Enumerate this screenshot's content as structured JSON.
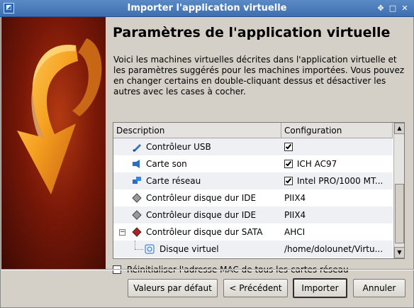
{
  "window": {
    "title": "Importer l'application virtuelle",
    "controls": [
      "up-arrow-icon",
      "restore-icon",
      "close-icon"
    ]
  },
  "page": {
    "heading": "Paramètres de l'application virtuelle",
    "description": "Voici les machines virtuelles décrites dans l'application virtuelle et les paramètres suggérés pour les machines importées. Vous pouvez en changer certains en double-cliquant dessus et désactiver les autres avec les cases à cocher."
  },
  "table": {
    "columns": [
      "Description",
      "Configuration"
    ],
    "rows": [
      {
        "icon": "usb-icon",
        "label": "Contrôleur USB",
        "checked": true,
        "value": ""
      },
      {
        "icon": "sound-card-icon",
        "label": "Carte son",
        "checked": true,
        "value": "ICH AC97"
      },
      {
        "icon": "network-card-icon",
        "label": "Carte réseau",
        "checked": true,
        "value": "Intel PRO/1000 MT..."
      },
      {
        "icon": "ide-controller-icon",
        "label": "Contrôleur disque dur IDE",
        "checked": null,
        "value": "PIIX4"
      },
      {
        "icon": "ide-controller-icon",
        "label": "Contrôleur disque dur IDE",
        "checked": null,
        "value": "PIIX4"
      },
      {
        "icon": "sata-controller-icon",
        "label": "Contrôleur disque dur SATA",
        "checked": null,
        "value": "AHCI"
      },
      {
        "icon": "virtual-disk-icon",
        "label": "Disque virtuel",
        "checked": null,
        "value": "/home/dolounet/Virtu..."
      }
    ]
  },
  "options": {
    "reset_mac_label": "Réinitialiser l'adresse MAC de tous les cartes réseau",
    "reset_mac_checked": false
  },
  "buttons": {
    "defaults": "Valeurs par défaut",
    "previous": "< Précédent",
    "import": "Importer",
    "cancel": "Annuler"
  },
  "colors": {
    "titlebar": "#4a7cc0",
    "banner": "#7a1808",
    "banner_arrow": "#f5a020"
  }
}
